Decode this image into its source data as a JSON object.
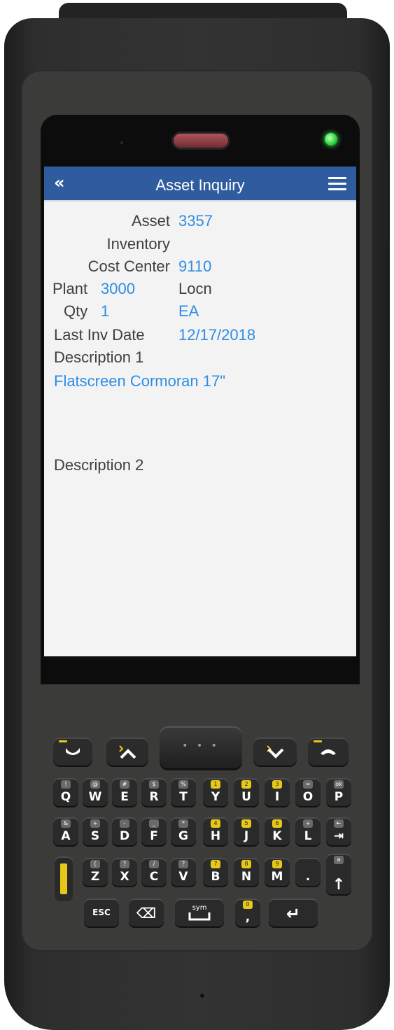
{
  "app": {
    "title": "Asset Inquiry"
  },
  "form": {
    "asset_label": "Asset",
    "asset_value": "3357",
    "inventory_label": "Inventory",
    "cost_center_label": "Cost Center",
    "cost_center_value": "9110",
    "plant_label": "Plant",
    "plant_value": "3000",
    "locn_label": "Locn",
    "qty_label": "Qty",
    "qty_value": "1",
    "uom_value": "EA",
    "last_inv_date_label": "Last Inv Date",
    "last_inv_date_value": "12/17/2018",
    "description1_label": "Description 1",
    "description1_value": "Flatscreen Cormoran 17\"",
    "description2_label": "Description 2"
  },
  "colors": {
    "header_bg": "#2e5c9e",
    "value_text": "#2f8de4",
    "label_text": "#3e3e3e",
    "screen_bg": "#f3f3f3",
    "led": "#2bdc3c"
  },
  "icons": {
    "back": "double-chevron-left-icon",
    "menu": "hamburger-menu-icon"
  },
  "keypad": {
    "center": "• • •",
    "row1": [
      {
        "main": "Q",
        "sub": "!"
      },
      {
        "main": "W",
        "sub": "@"
      },
      {
        "main": "E",
        "sub": "#"
      },
      {
        "main": "R",
        "sub": "$"
      },
      {
        "main": "T",
        "sub": "%"
      },
      {
        "main": "Y",
        "sub": "1",
        "yellow": true
      },
      {
        "main": "U",
        "sub": "2",
        "yellow": true
      },
      {
        "main": "I",
        "sub": "3",
        "yellow": true
      },
      {
        "main": "O",
        "sub": "="
      },
      {
        "main": "P",
        "sub": "ok"
      }
    ],
    "row2": [
      {
        "main": "A",
        "sub": "&"
      },
      {
        "main": "S",
        "sub": "+"
      },
      {
        "main": "D",
        "sub": "-"
      },
      {
        "main": "F",
        "sub": "_"
      },
      {
        "main": "G",
        "sub": "*"
      },
      {
        "main": "H",
        "sub": "4",
        "yellow": true
      },
      {
        "main": "J",
        "sub": "5",
        "yellow": true
      },
      {
        "main": "K",
        "sub": "6",
        "yellow": true
      },
      {
        "main": "L",
        "sub": "+"
      },
      {
        "main": "⇥",
        "sub": "⇤"
      }
    ],
    "row3": [
      {
        "main": "Z",
        "sub": "("
      },
      {
        "main": "X",
        "sub": "?"
      },
      {
        "main": "C",
        "sub": "/"
      },
      {
        "main": "V",
        "sub": "?"
      },
      {
        "main": "B",
        "sub": "7",
        "yellow": true
      },
      {
        "main": "N",
        "sub": "8",
        "yellow": true
      },
      {
        "main": "M",
        "sub": "9",
        "yellow": true
      },
      {
        "main": ".",
        "sub": ""
      },
      {
        "main": "↑",
        "sub": "a"
      }
    ],
    "esc": "ESC",
    "backspace": "⌫",
    "sym": "sym",
    "comma": ",",
    "comma_sub": "0",
    "enter": "↵"
  }
}
